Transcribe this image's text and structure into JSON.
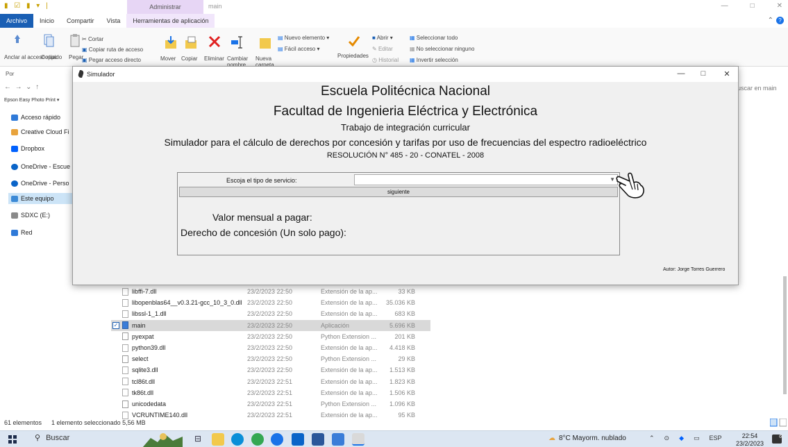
{
  "explorer": {
    "ctx_tab_title": "Administrar",
    "window_title": "main",
    "tabs": [
      "Archivo",
      "Inicio",
      "Compartir",
      "Vista",
      "Herramientas de aplicación"
    ],
    "ribbon": {
      "anclar": "Anclar al acceso rápido",
      "copiar": "Copiar",
      "pegar": "Pegar",
      "cortar": "Cortar",
      "copiar_ruta": "Copiar ruta de acceso",
      "pegar_acceso": "Pegar acceso directo",
      "mover": "Mover",
      "copiar2": "Copiar",
      "eliminar": "Eliminar",
      "cambiar": "Cambiar nombre",
      "nueva": "Nueva carpeta",
      "nuevo_elemento": "Nuevo elemento ▾",
      "facil_acceso": "Fácil acceso ▾",
      "propiedades": "Propiedades",
      "abrir": "Abrir ▾",
      "editar": "Editar",
      "historial": "Historial",
      "sel_todo": "Seleccionar todo",
      "no_sel": "No seleccionar ninguno",
      "invertir": "Invertir selección",
      "por": "Por"
    },
    "search_placeholder": "uscar en main",
    "epson_item": "Epson Easy Photo Print ▾",
    "sidebar": [
      {
        "label": "Acceso rápido",
        "color": "#2f7ad8"
      },
      {
        "label": "Creative Cloud Fi",
        "color": "#e8a33c"
      },
      {
        "label": "Dropbox",
        "color": "#0061fe"
      },
      {
        "label": "OneDrive - Escue",
        "color": "#0a64c8"
      },
      {
        "label": "OneDrive - Perso",
        "color": "#0a64c8"
      },
      {
        "label": "Este equipo",
        "color": "#3c8ad6"
      },
      {
        "label": "SDXC (E:)",
        "color": "#8a8a8a"
      },
      {
        "label": "Red",
        "color": "#2f7ad8"
      }
    ],
    "files": [
      {
        "name": "libffi-7.dll",
        "date": "23/2/2023 22:50",
        "type": "Extensión de la ap...",
        "size": "33 KB",
        "kind": "dll"
      },
      {
        "name": "libopenblas64__v0.3.21-gcc_10_3_0.dll",
        "date": "23/2/2023 22:50",
        "type": "Extensión de la ap...",
        "size": "35.036 KB",
        "kind": "dll"
      },
      {
        "name": "libssl-1_1.dll",
        "date": "23/2/2023 22:50",
        "type": "Extensión de la ap...",
        "size": "683 KB",
        "kind": "dll"
      },
      {
        "name": "main",
        "date": "23/2/2023 22:50",
        "type": "Aplicación",
        "size": "5.696 KB",
        "kind": "app",
        "selected": true
      },
      {
        "name": "pyexpat",
        "date": "23/2/2023 22:50",
        "type": "Python Extension ...",
        "size": "201 KB",
        "kind": "pyd"
      },
      {
        "name": "python39.dll",
        "date": "23/2/2023 22:50",
        "type": "Extensión de la ap...",
        "size": "4.418 KB",
        "kind": "dll"
      },
      {
        "name": "select",
        "date": "23/2/2023 22:50",
        "type": "Python Extension ...",
        "size": "29 KB",
        "kind": "pyd"
      },
      {
        "name": "sqlite3.dll",
        "date": "23/2/2023 22:50",
        "type": "Extensión de la ap...",
        "size": "1.513 KB",
        "kind": "dll"
      },
      {
        "name": "tcl86t.dll",
        "date": "23/2/2023 22:51",
        "type": "Extensión de la ap...",
        "size": "1.823 KB",
        "kind": "dll"
      },
      {
        "name": "tk86t.dll",
        "date": "23/2/2023 22:51",
        "type": "Extensión de la ap...",
        "size": "1.506 KB",
        "kind": "dll"
      },
      {
        "name": "unicodedata",
        "date": "23/2/2023 22:51",
        "type": "Python Extension ...",
        "size": "1.096 KB",
        "kind": "pyd"
      },
      {
        "name": "VCRUNTIME140.dll",
        "date": "23/2/2023 22:51",
        "type": "Extensión de la ap...",
        "size": "95 KB",
        "kind": "dll"
      }
    ],
    "status": {
      "count": "61 elementos",
      "selection": "1 elemento seleccionado 5,56 MB"
    }
  },
  "simulador": {
    "window_title": "Simulador",
    "line1": "Escuela Politécnica Nacional",
    "line2": "Facultad de Ingenieria Eléctrica y Electrónica",
    "line3": "Trabajo de integración curricular",
    "line4": "Simulador para el cálculo de derechos por concesión y tarifas por uso  de frecuencias del espectro radioeléctrico",
    "line5": "RESOLUCIÓN N° 485 - 20 - CONATEL - 2008",
    "service_label": "Escoja el tipo de servicio:",
    "service_value": "",
    "next_button": "siguiente",
    "valor_label": "Valor mensual a pagar:",
    "derecho_label": "Derecho de concesión (Un solo pago):",
    "autor": "Autor: Jorge Torres Guerrero"
  },
  "taskbar": {
    "search": "Buscar",
    "weather": "8°C  Mayorm. nublado",
    "lang": "ESP",
    "time": "22:54",
    "date": "23/2/2023",
    "notif_count": "6"
  }
}
